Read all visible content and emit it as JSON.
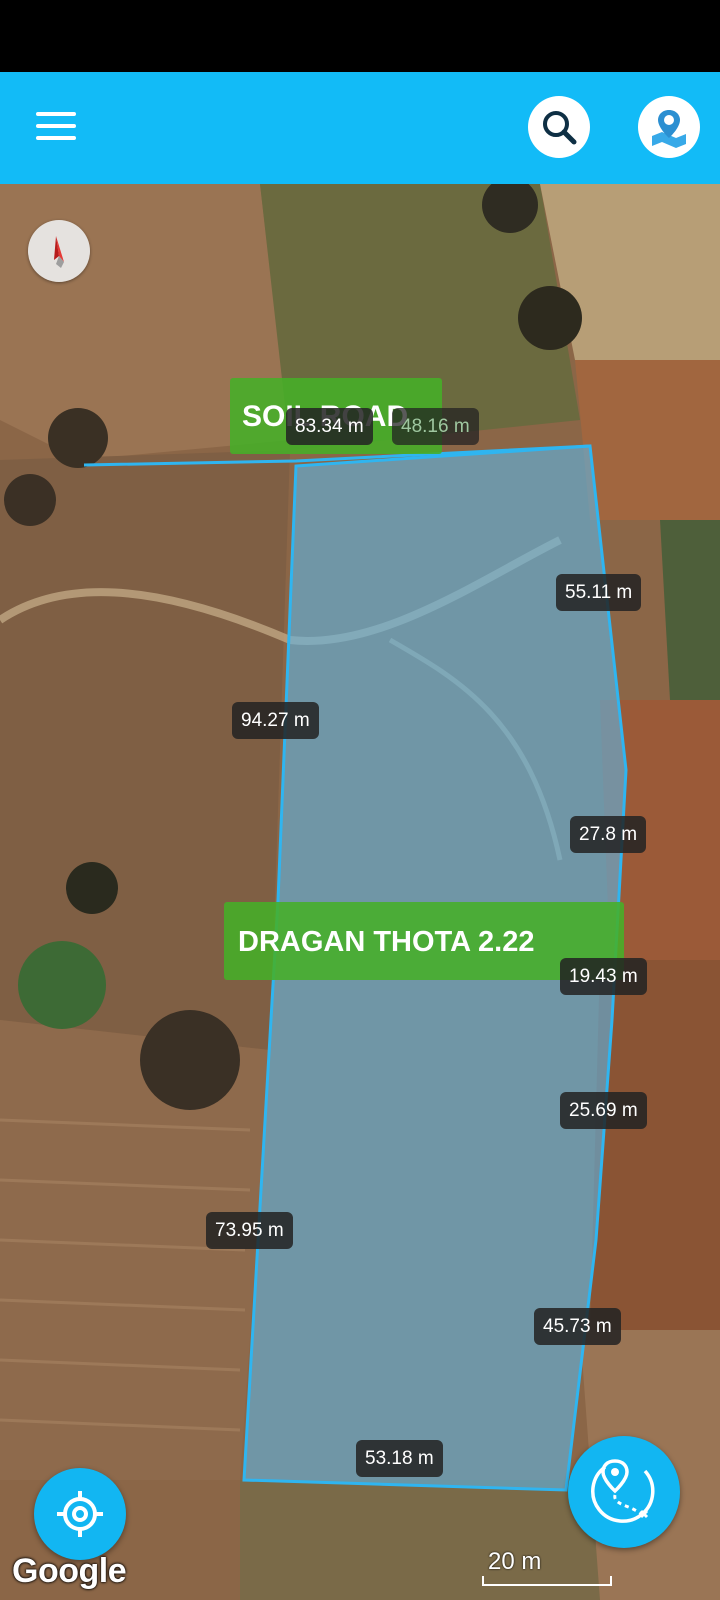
{
  "toolbar": {
    "menu_icon": "hamburger-menu-icon",
    "search_icon": "search-icon",
    "map_pin_icon": "map-location-icon",
    "accent_color": "#12bbf7"
  },
  "map": {
    "compass_icon": "compass-icon",
    "labels": {
      "road": "SOIL ROAD",
      "field": "DRAGAN THOTA  2.22"
    },
    "segments": [
      {
        "text": "83.34 m"
      },
      {
        "text": "48.16 m"
      },
      {
        "text": "55.11 m"
      },
      {
        "text": "94.27 m"
      },
      {
        "text": "27.8 m"
      },
      {
        "text": "19.43 m"
      },
      {
        "text": "25.69 m"
      },
      {
        "text": "73.95 m"
      },
      {
        "text": "45.73 m"
      },
      {
        "text": "53.18 m"
      }
    ],
    "polygon_fill": "#5fb6e6",
    "polygon_stroke": "#2fb5f0",
    "attribution": "Google",
    "scale": "20 m",
    "locate_icon": "crosshair-location-icon",
    "route_icon": "route-measure-icon"
  }
}
